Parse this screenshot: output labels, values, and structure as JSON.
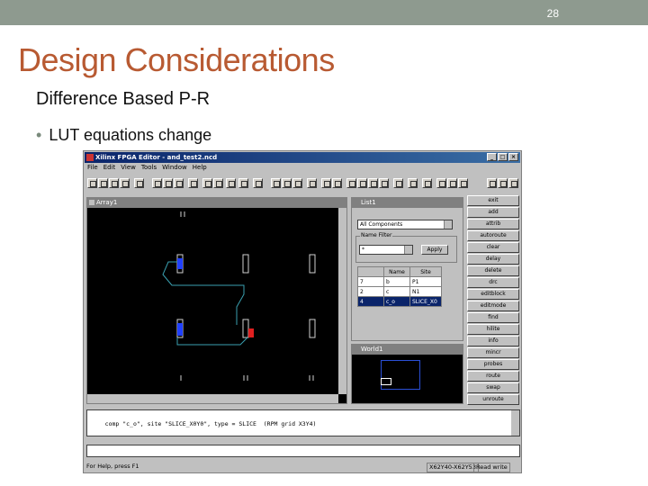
{
  "slide": {
    "page_number": "28",
    "title": "Design Considerations",
    "subtitle": "Difference Based P-R",
    "bullet": "LUT equations change"
  },
  "app": {
    "window_title": "Xilinx FPGA Editor - and_test2.ncd",
    "menu": [
      "File",
      "Edit",
      "View",
      "Tools",
      "Window",
      "Help"
    ],
    "array_window_title": "Array1",
    "list_window_title": "List1",
    "world_window_title": "World1",
    "component_filter": "All Components",
    "name_filter_label": "Name Filter",
    "name_filter_value": "*",
    "apply_label": "Apply",
    "table": {
      "headers": [
        "",
        "Name",
        "Site"
      ],
      "rows": [
        [
          "7",
          "b",
          "P1"
        ],
        [
          "2",
          "c",
          "N1"
        ],
        [
          "4",
          "c_o",
          "SLICE_X0"
        ]
      ]
    },
    "commands": [
      "exit",
      "add",
      "attrib",
      "autoroute",
      "clear",
      "delay",
      "delete",
      "drc",
      "editblock",
      "editmode",
      "find",
      "hilite",
      "info",
      "mincr",
      "probes",
      "route",
      "swap",
      "unroute"
    ],
    "history_line": "comp \"c_o\", site \"SLICE_X0Y0\", type = SLICE  (RPM grid X3Y4)",
    "status_help": "For Help, press F1",
    "status_coord": "X62Y40-X62Y53",
    "status_mode": "Read write"
  }
}
